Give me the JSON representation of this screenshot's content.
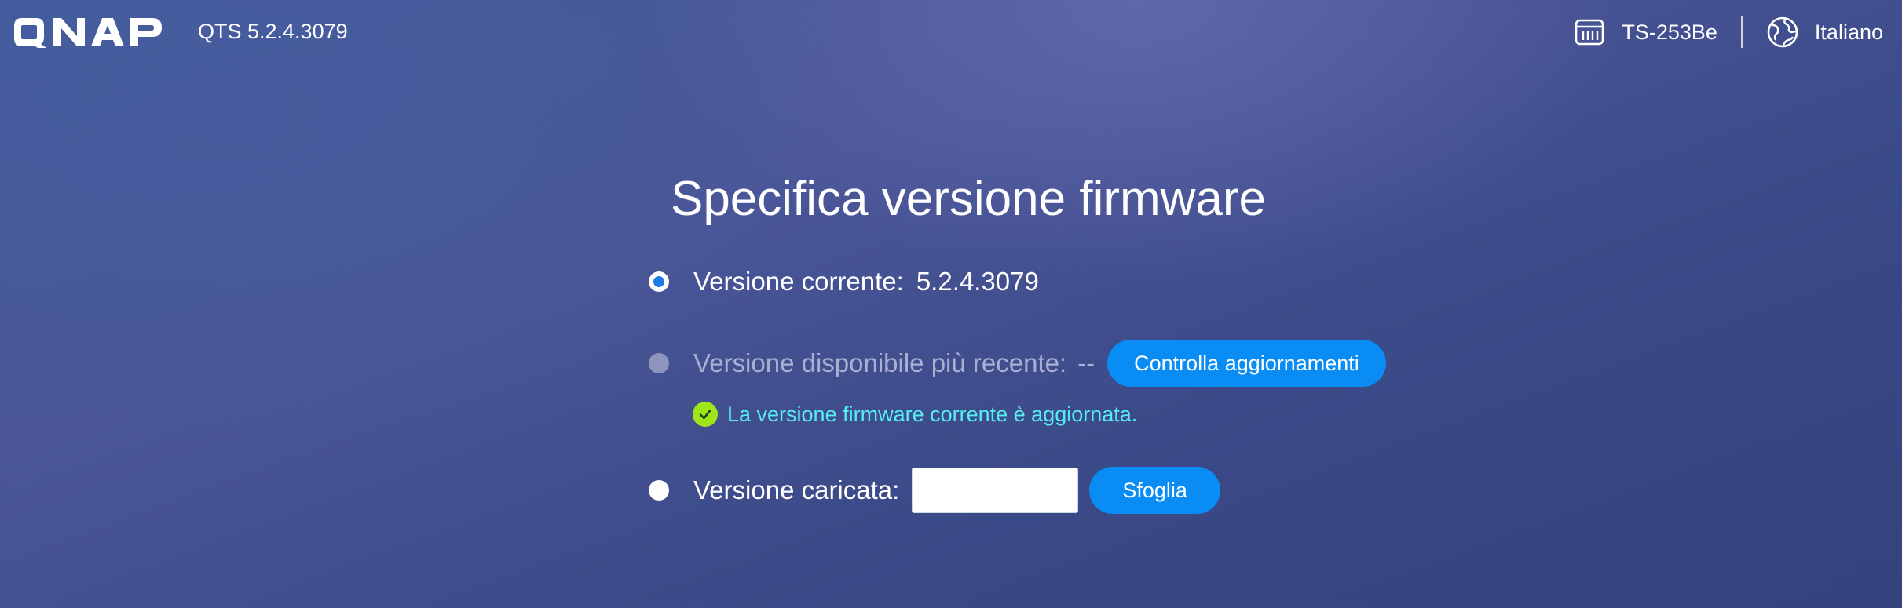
{
  "header": {
    "logo_text": "QNAP",
    "firmware_version": "QTS 5.2.4.3079",
    "device_icon": "nas-device-icon",
    "device_name": "TS-253Be",
    "language_icon": "globe-icon",
    "language": "Italiano"
  },
  "main": {
    "title": "Specifica versione firmware",
    "current": {
      "label": "Versione corrente:",
      "value": "5.2.4.3079",
      "selected": true
    },
    "latest": {
      "label": "Versione disponibile più recente:",
      "value": "--",
      "button_label": "Controlla aggiornamenti",
      "enabled": false
    },
    "status": {
      "icon": "check-circle-icon",
      "message": "La versione firmware corrente è aggiornata."
    },
    "uploaded": {
      "label": "Versione caricata:",
      "input_value": "",
      "button_label": "Sfoglia"
    }
  },
  "colors": {
    "accent": "#0a8cf5",
    "status_text": "#55eef0",
    "status_icon": "#9ee51a"
  }
}
